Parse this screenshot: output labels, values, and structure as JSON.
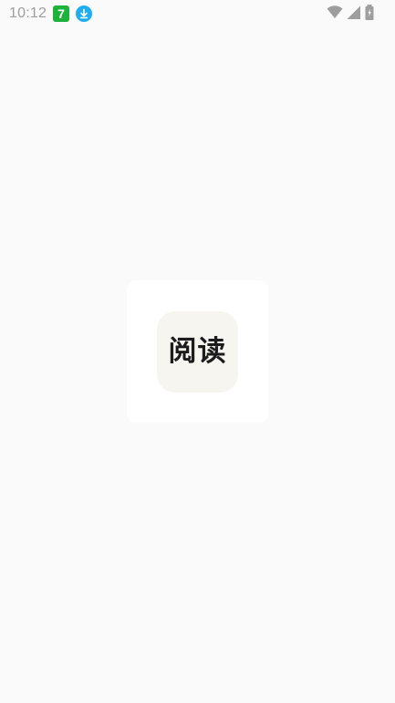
{
  "status_bar": {
    "time": "10:12",
    "notifications": [
      {
        "icon": "seven-app-icon",
        "glyph": "7",
        "color": "#1db33a"
      },
      {
        "icon": "download-icon",
        "color": "#1eaef0"
      }
    ],
    "indicators": [
      "wifi-icon",
      "cellular-signal-icon",
      "battery-icon"
    ],
    "indicator_color": "#9e9e9e"
  },
  "splash": {
    "app_icon_label": "阅读",
    "card_color": "#ffffff",
    "icon_background": "#f6f5f0",
    "screen_background": "#fafafa"
  }
}
